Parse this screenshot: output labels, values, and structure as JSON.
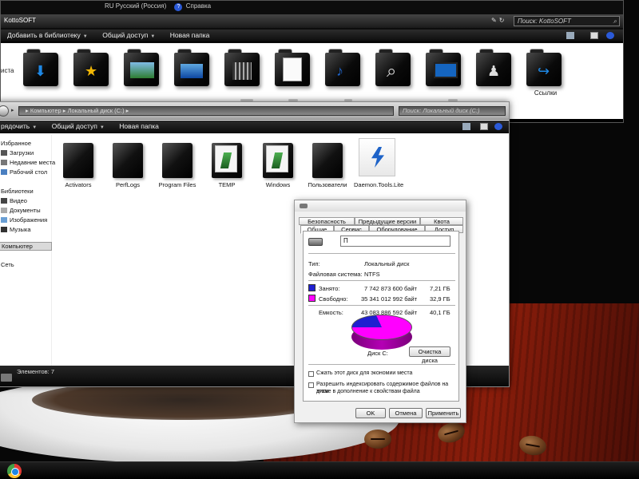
{
  "back_window": {
    "window_title": "KottoSOFT",
    "language_indicator": "RU Русский (Россия)",
    "help_label": "Справка",
    "search_placeholder": "Поиск: KottoSOFT",
    "toolbar": {
      "add_to_library": "Добавить в библиотеку",
      "share": "Общий доступ",
      "new_folder": "Новая папка"
    },
    "partial_left_label": "иста",
    "folders": [
      {
        "emblem": "download-arrow",
        "label": ""
      },
      {
        "emblem": "star",
        "label": ""
      },
      {
        "emblem": "landscape-photo",
        "label": ""
      },
      {
        "emblem": "desktop-screen",
        "label": ""
      },
      {
        "emblem": "film",
        "label": ""
      },
      {
        "emblem": "documents",
        "label": ""
      },
      {
        "emblem": "music-note",
        "label": ""
      },
      {
        "emblem": "magnifier",
        "label": ""
      },
      {
        "emblem": "monitor",
        "label": ""
      },
      {
        "emblem": "chess-pawn-puzzle",
        "label": ""
      },
      {
        "emblem": "shortcut-arrow",
        "label": "Ссылки"
      }
    ]
  },
  "front_window": {
    "address_path": "▸ Компьютер ▸ Локальный диск (C:) ▸",
    "search_placeholder": "Поиск: Локальный диск (C:)",
    "toolbar": {
      "organize": "рядочить",
      "share": "Общий доступ",
      "new_folder": "Новая папка"
    },
    "nav": {
      "favorites": "Избранное",
      "downloads": "Загрузки",
      "recent": "Недавние места",
      "desktop": "Рабочий стол",
      "libraries": "Библиотеки",
      "video": "Видео",
      "documents": "Документы",
      "pictures": "Изображения",
      "music": "Музыка",
      "computer": "Компьютер",
      "network": "Сеть"
    },
    "items": [
      {
        "label": "Activators",
        "kind": "black-folder"
      },
      {
        "label": "PerfLogs",
        "kind": "black-folder"
      },
      {
        "label": "Program Files",
        "kind": "black-folder"
      },
      {
        "label": "TEMP",
        "kind": "open-folder"
      },
      {
        "label": "Windows",
        "kind": "open-folder"
      },
      {
        "label": "Пользователи",
        "kind": "black-folder"
      },
      {
        "label": "Daemon.Tools.Lite",
        "kind": "daemon-tools-icon"
      }
    ],
    "status_text": "Элементов: 7"
  },
  "properties_dialog": {
    "tabs_row1": {
      "security": "Безопасность",
      "previous_versions": "Предыдущие версии",
      "quota": "Квота"
    },
    "tabs_row2": {
      "general": "Общие",
      "tools": "Сервис",
      "hardware": "Оборудование",
      "sharing": "Доступ"
    },
    "disk_name_value": "П",
    "type_label": "Тип:",
    "type_value": "Локальный диск",
    "fs_label": "Файловая система:",
    "fs_value": "NTFS",
    "used_label": "Занято:",
    "used_bytes": "7 742 873 600 байт",
    "used_size": "7,21 ГБ",
    "free_label": "Свободно:",
    "free_bytes": "35 341 012 992 байт",
    "free_size": "32,9 ГБ",
    "capacity_label": "Емкость:",
    "capacity_bytes": "43 083 886 592 байт",
    "capacity_size": "40,1 ГБ",
    "disk_caption": "Диск C:",
    "cleanup_button": "Очистка диска",
    "compress_checkbox": "Сжать этот диск для экономии места",
    "index_checkbox_line1": "Разрешить индексировать содержимое файлов на этом",
    "index_checkbox_line2": "диске в дополнение к свойствам файла",
    "ok_button": "OK",
    "cancel_button": "Отмена",
    "apply_button": "Применить",
    "used_fraction": 0.1797,
    "colors": {
      "used": "#1f1fd0",
      "free": "#ff00ff"
    }
  },
  "taskbar": {
    "pinned": [
      "chrome-icon"
    ]
  }
}
